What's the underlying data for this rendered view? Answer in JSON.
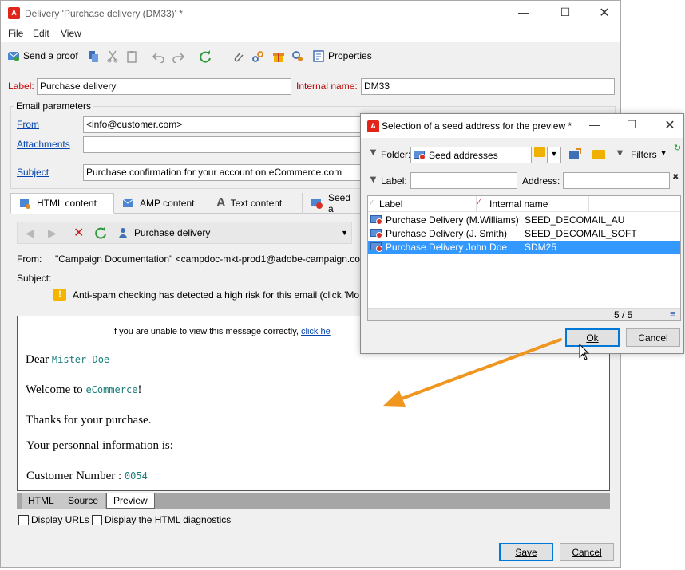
{
  "window": {
    "title": "Delivery 'Purchase delivery (DM33)' *",
    "app_logo": "A"
  },
  "menu": [
    "File",
    "Edit",
    "View"
  ],
  "toolbar": {
    "send_proof": "Send a proof",
    "properties": "Properties"
  },
  "form": {
    "label_caption": "Label:",
    "label_value": "Purchase delivery",
    "internal_name_caption": "Internal name:",
    "internal_name_value": "DM33",
    "email_params_title": "Email parameters",
    "from_caption": "From",
    "from_value": "<info@customer.com>",
    "attachments_caption": "Attachments",
    "attachments_value": "",
    "subject_caption": "Subject",
    "subject_value": "Purchase confirmation for your account on eCommerce.com"
  },
  "content_tabs": [
    {
      "label": "HTML content"
    },
    {
      "label": "AMP content"
    },
    {
      "label": "Text content"
    },
    {
      "label": "Seed a"
    }
  ],
  "preview": {
    "recipient": "Purchase delivery",
    "from_caption": "From:",
    "from_value": "\"Campaign Documentation\" <campdoc-mkt-prod1@adobe-campaign.co",
    "subject_caption": "Subject:",
    "antispam_text": "Anti-spam checking has detected a high risk for this email (click 'Mo",
    "notice_text": "If you are unable to view this message correctly,",
    "notice_link": "click he",
    "dear": "Dear",
    "dear_name": "Mister Doe",
    "welcome": "Welcome to",
    "welcome_site": "eCommerce",
    "welcome_end": "!",
    "thanks": "Thanks for your purchase.",
    "personal_info": "Your personnal information is:",
    "customer_number_label": "Customer Number :",
    "customer_number_value": "0054"
  },
  "bottom_tabs": [
    "HTML",
    "Source",
    "Preview"
  ],
  "options": {
    "display_urls": "Display URLs",
    "display_diagnostics": "Display the HTML diagnostics"
  },
  "buttons": {
    "save": "Save",
    "cancel": "Cancel"
  },
  "dialog": {
    "title": "Selection of a seed address for the preview *",
    "folder_caption": "Folder:",
    "folder_value": "Seed addresses",
    "filters": "Filters",
    "label_caption": "Label:",
    "label_value": "",
    "address_caption": "Address:",
    "address_value": "",
    "columns": [
      "Label",
      "Internal name"
    ],
    "rows": [
      {
        "label": "Purchase Delivery (M.Williams)",
        "internal_name": "SEED_DECOMAIL_AU"
      },
      {
        "label": "Purchase Delivery (J. Smith)",
        "internal_name": "SEED_DECOMAIL_SOFT"
      },
      {
        "label": "Purchase Delivery John Doe",
        "internal_name": "SDM25"
      }
    ],
    "count": "5 / 5",
    "ok": "Ok",
    "cancel": "Cancel"
  },
  "colors": {
    "accent_red": "#c00000",
    "selection_blue": "#3399ff",
    "arrow_orange": "#f0961e"
  }
}
